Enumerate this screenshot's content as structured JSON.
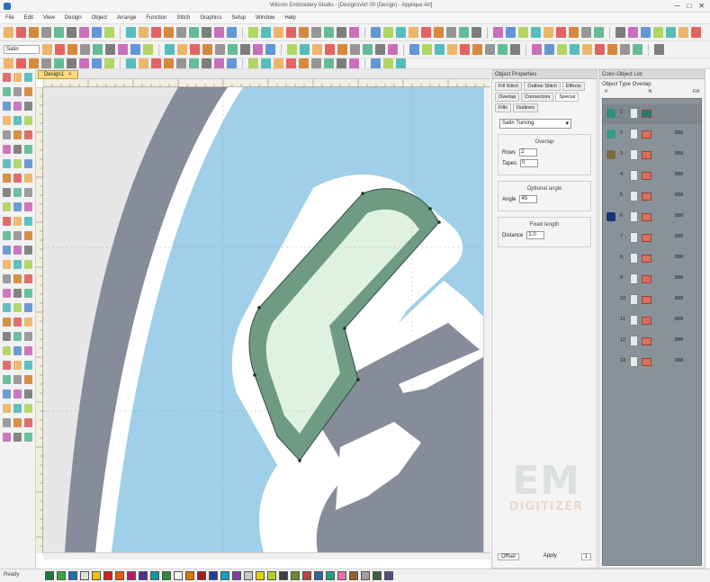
{
  "window": {
    "title": "Wilcom Embroidery Studio - [Designs\\Art 00 (Design) - Applique Art]",
    "controls": [
      "─",
      "□",
      "✕"
    ]
  },
  "menu": [
    "File",
    "Edit",
    "View",
    "Design",
    "Object",
    "Arrange",
    "Function",
    "Stitch",
    "Graphics",
    "Setup",
    "Window",
    "Help"
  ],
  "toolbar": {
    "style_field": "Satin",
    "zoom_field": "100%"
  },
  "document": {
    "tab_label": "Design1",
    "tab_close": "×"
  },
  "object_properties": {
    "header": "Object Properties",
    "tabs": [
      "Fill Stitch",
      "Outline Stitch",
      "Effects",
      "Overlap",
      "Connectors",
      "Special",
      "Fills",
      "Outlines"
    ],
    "active_tab": "Special",
    "fill_type": "Satin Turning",
    "groups": [
      {
        "title": "Overlap",
        "rows": [
          {
            "label": "Rows",
            "value": "2"
          },
          {
            "label": "Tapes",
            "value": "0"
          }
        ]
      },
      {
        "title": "Optional angle",
        "rows": [
          {
            "label": "Angle",
            "value": "45"
          }
        ]
      },
      {
        "title": "Fixed length",
        "rows": [
          {
            "label": "Distance",
            "value": "1.0"
          }
        ]
      }
    ],
    "bottom": {
      "left_label": "Offset",
      "right_label": "Apply",
      "right_value": "1"
    }
  },
  "sequence_panel": {
    "header": "Color-Object List",
    "toolbar_label": "Object Type  Overlap",
    "columns": [
      "#",
      "N",
      "Fill"
    ],
    "rows": [
      {
        "num": "1",
        "thumb": "#2f8f7e",
        "swatch": "#1e7f70",
        "count": ""
      },
      {
        "num": "2",
        "thumb": "#3a9a8a",
        "swatch": "#d9705f",
        "count": "888"
      },
      {
        "num": "3",
        "thumb": "#7b6d3b",
        "swatch": "#d9705f",
        "count": "888"
      },
      {
        "num": "4",
        "thumb": "#8a9299",
        "swatch": "#d9705f",
        "count": "888"
      },
      {
        "num": "5",
        "thumb": "#8a9299",
        "swatch": "#d9705f",
        "count": "888"
      },
      {
        "num": "6",
        "thumb": "#17337a",
        "swatch": "#d9705f",
        "count": "888"
      },
      {
        "num": "7",
        "thumb": "#8a9299",
        "swatch": "#d9705f",
        "count": "888"
      },
      {
        "num": "8",
        "thumb": "#8a9299",
        "swatch": "#d9705f",
        "count": "888"
      },
      {
        "num": "9",
        "thumb": "#8a9299",
        "swatch": "#d9705f",
        "count": "888"
      },
      {
        "num": "10",
        "thumb": "#8a9299",
        "swatch": "#d9705f",
        "count": "888"
      },
      {
        "num": "11",
        "thumb": "#8a9299",
        "swatch": "#d9705f",
        "count": "888"
      },
      {
        "num": "12",
        "thumb": "#8a9299",
        "swatch": "#d9705f",
        "count": "888"
      },
      {
        "num": "13",
        "thumb": "#8a9299",
        "swatch": "#d9705f",
        "count": "888"
      }
    ]
  },
  "palette": [
    "#1f7a3a",
    "#3fa34d",
    "#1b6fb5",
    "#e0e0e0",
    "#f2c200",
    "#d02020",
    "#e05a10",
    "#b21d6c",
    "#5a2a8a",
    "#0a9a9a",
    "#2e8b3a",
    "#f5f5f5",
    "#d97700",
    "#a31c1c",
    "#2b3a8c",
    "#10a0c8",
    "#7f3fa0",
    "#c8c8c8",
    "#e8d000",
    "#b0d030",
    "#404040",
    "#6a8c2a",
    "#c04040",
    "#3060a0",
    "#20a080",
    "#e070b0",
    "#906030",
    "#a0a0a0",
    "#406040",
    "#505080"
  ],
  "statusbar": {
    "text": "Ready"
  },
  "canvas_colors": {
    "sky": "#9fcfe9",
    "grey_band": "#868c99",
    "white_outline": "#ffffff",
    "fill_selected": "#dff2e2",
    "satin_border": "#6f9a84"
  },
  "watermark": {
    "line1": "EM",
    "line2": "DIGITIZER"
  }
}
